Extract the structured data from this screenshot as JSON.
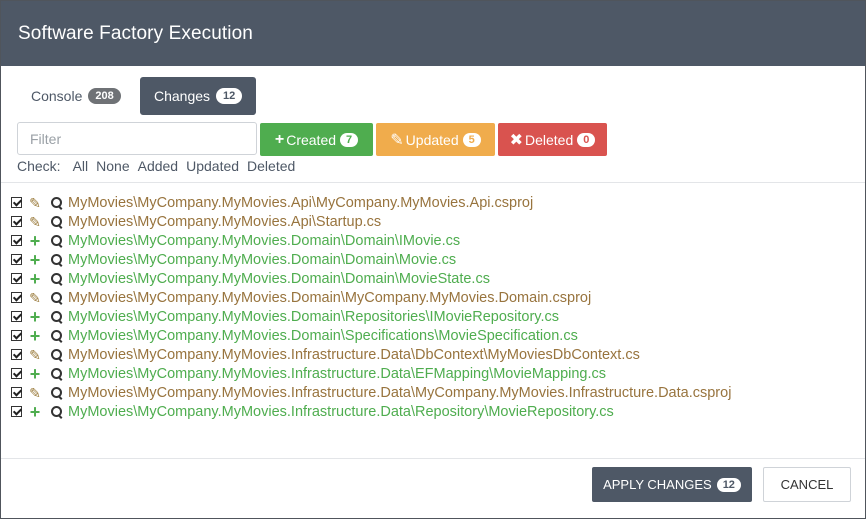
{
  "dialog": {
    "title": "Software Factory Execution"
  },
  "tabs": {
    "console": {
      "label": "Console",
      "count": "208"
    },
    "changes": {
      "label": "Changes",
      "count": "12"
    }
  },
  "filter": {
    "placeholder": "Filter",
    "value": ""
  },
  "filter_buttons": {
    "created": {
      "label": "Created",
      "count": "7",
      "color": "#4fad4f",
      "icon": "plus-icon"
    },
    "updated": {
      "label": "Updated",
      "count": "5",
      "color": "#f0ac4c",
      "icon": "pencil-icon"
    },
    "deleted": {
      "label": "Deleted",
      "count": "0",
      "color": "#d9534f",
      "icon": "times-icon"
    }
  },
  "check": {
    "label": "Check:",
    "links": [
      "All",
      "None",
      "Added",
      "Updated",
      "Deleted"
    ]
  },
  "files": [
    {
      "status": "updated",
      "path": "MyMovies\\MyCompany.MyMovies.Api\\MyCompany.MyMovies.Api.csproj"
    },
    {
      "status": "updated",
      "path": "MyMovies\\MyCompany.MyMovies.Api\\Startup.cs"
    },
    {
      "status": "created",
      "path": "MyMovies\\MyCompany.MyMovies.Domain\\Domain\\IMovie.cs"
    },
    {
      "status": "created",
      "path": "MyMovies\\MyCompany.MyMovies.Domain\\Domain\\Movie.cs"
    },
    {
      "status": "created",
      "path": "MyMovies\\MyCompany.MyMovies.Domain\\Domain\\MovieState.cs"
    },
    {
      "status": "updated",
      "path": "MyMovies\\MyCompany.MyMovies.Domain\\MyCompany.MyMovies.Domain.csproj"
    },
    {
      "status": "created",
      "path": "MyMovies\\MyCompany.MyMovies.Domain\\Repositories\\IMovieRepository.cs"
    },
    {
      "status": "created",
      "path": "MyMovies\\MyCompany.MyMovies.Domain\\Specifications\\MovieSpecification.cs"
    },
    {
      "status": "updated",
      "path": "MyMovies\\MyCompany.MyMovies.Infrastructure.Data\\DbContext\\MyMoviesDbContext.cs"
    },
    {
      "status": "created",
      "path": "MyMovies\\MyCompany.MyMovies.Infrastructure.Data\\EFMapping\\MovieMapping.cs"
    },
    {
      "status": "updated",
      "path": "MyMovies\\MyCompany.MyMovies.Infrastructure.Data\\MyCompany.MyMovies.Infrastructure.Data.csproj"
    },
    {
      "status": "created",
      "path": "MyMovies\\MyCompany.MyMovies.Infrastructure.Data\\Repository\\MovieRepository.cs"
    }
  ],
  "footer": {
    "apply_label": "APPLY CHANGES",
    "apply_count": "12",
    "cancel_label": "CANCEL"
  }
}
